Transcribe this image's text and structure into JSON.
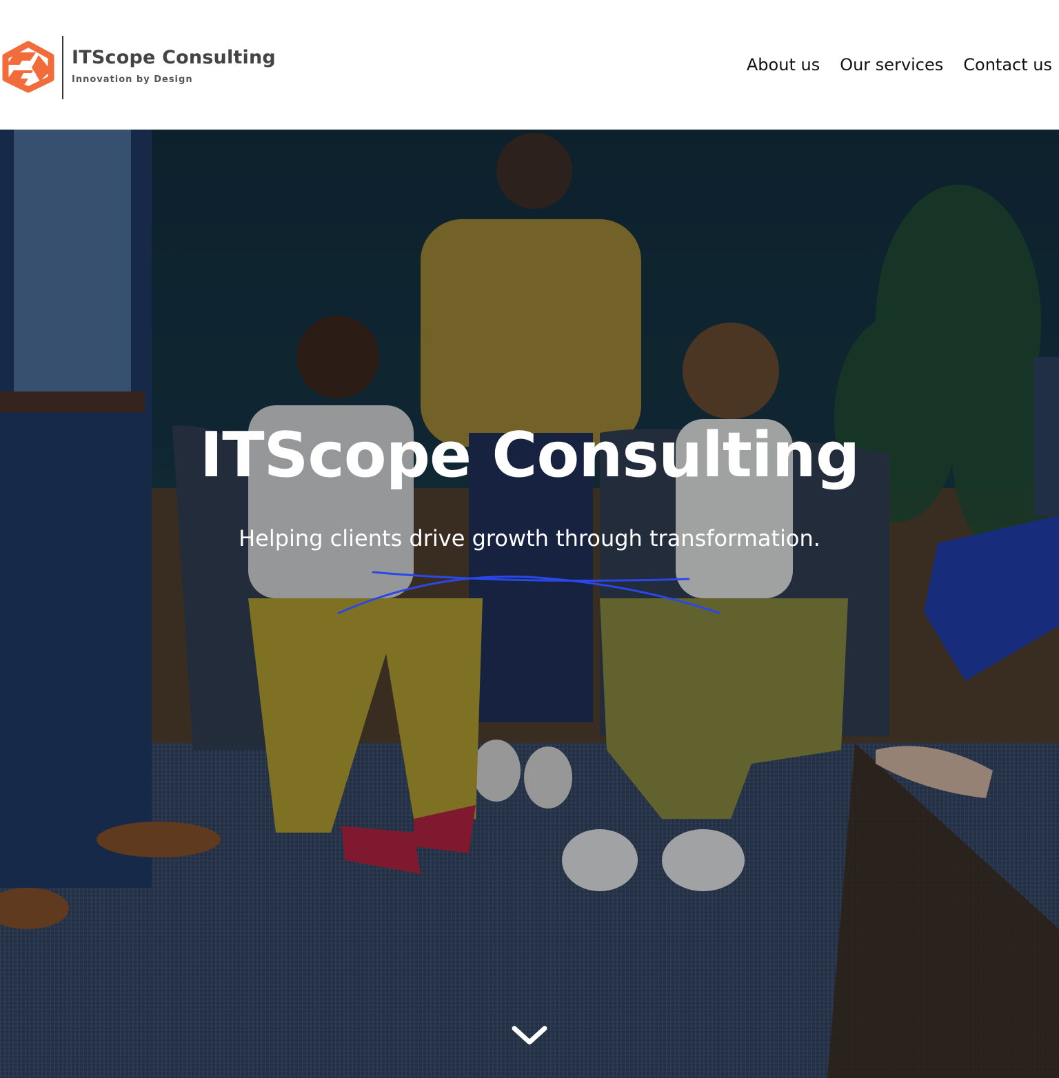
{
  "header": {
    "logo": {
      "name": "ITScope Consulting",
      "tagline": "Innovation by Design",
      "mark_color": "#f26b3a"
    },
    "nav": [
      {
        "label": "About us"
      },
      {
        "label": "Our services"
      },
      {
        "label": "Contact us"
      }
    ]
  },
  "hero": {
    "title": "ITScope Consulting",
    "subtitle": "Helping clients drive growth through transformation.",
    "accent_color": "#2a48e8",
    "scroll_icon": "chevron-down-icon"
  }
}
